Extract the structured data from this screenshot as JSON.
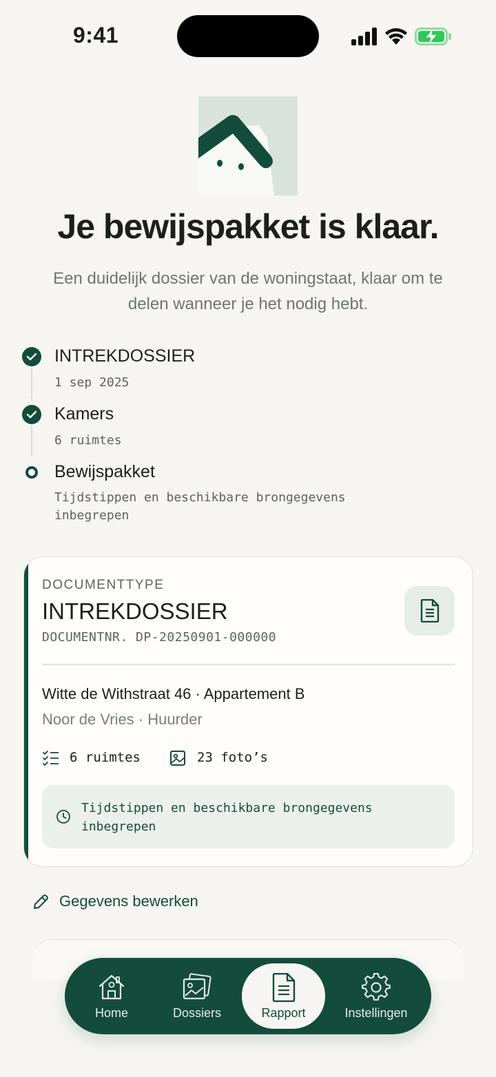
{
  "status_bar": {
    "time": "9:41"
  },
  "hero": {
    "title": "Je bewijspakket is klaar.",
    "subtitle": "Een duidelijk dossier van de woningstaat, klaar om te delen wanneer je het nodig hebt."
  },
  "timeline": {
    "steps": [
      {
        "label": "INTREKDOSSIER",
        "meta": "1 sep 2025",
        "state": "done"
      },
      {
        "label": "Kamers",
        "meta": "6 ruimtes",
        "state": "done"
      },
      {
        "label": "Bewijspakket",
        "meta": "Tijdstippen en beschikbare brongegevens inbegrepen",
        "state": "current"
      }
    ]
  },
  "card": {
    "kicker": "DOCUMENTTYPE",
    "title": "INTREKDOSSIER",
    "doc_number": "DOCUMENTNR. DP-20250901-000000",
    "address": "Witte de Withstraat 46 · Appartement B",
    "person": "Noor de Vries · Huurder",
    "rooms": "6 ruimtes",
    "photos": "23 foto’s",
    "note": "Tijdstippen en beschikbare brongegevens inbegrepen",
    "icons": [
      "document-icon",
      "checklist-icon",
      "image-icon",
      "clock-icon"
    ]
  },
  "edit_link": {
    "label": "Gegevens bewerken",
    "icon": "pencil-icon"
  },
  "tabbar": {
    "tabs": [
      {
        "label": "Home",
        "icon": "house-icon",
        "active": false
      },
      {
        "label": "Dossiers",
        "icon": "photos-icon",
        "active": false
      },
      {
        "label": "Rapport",
        "icon": "document-icon",
        "active": true
      },
      {
        "label": "Instellingen",
        "icon": "gear-icon",
        "active": false
      }
    ]
  },
  "colors": {
    "brand": "#144c3b",
    "background": "#f6f5f2",
    "card": "#fefdfb",
    "muted_text": "#707572",
    "battery": "#34c759"
  }
}
